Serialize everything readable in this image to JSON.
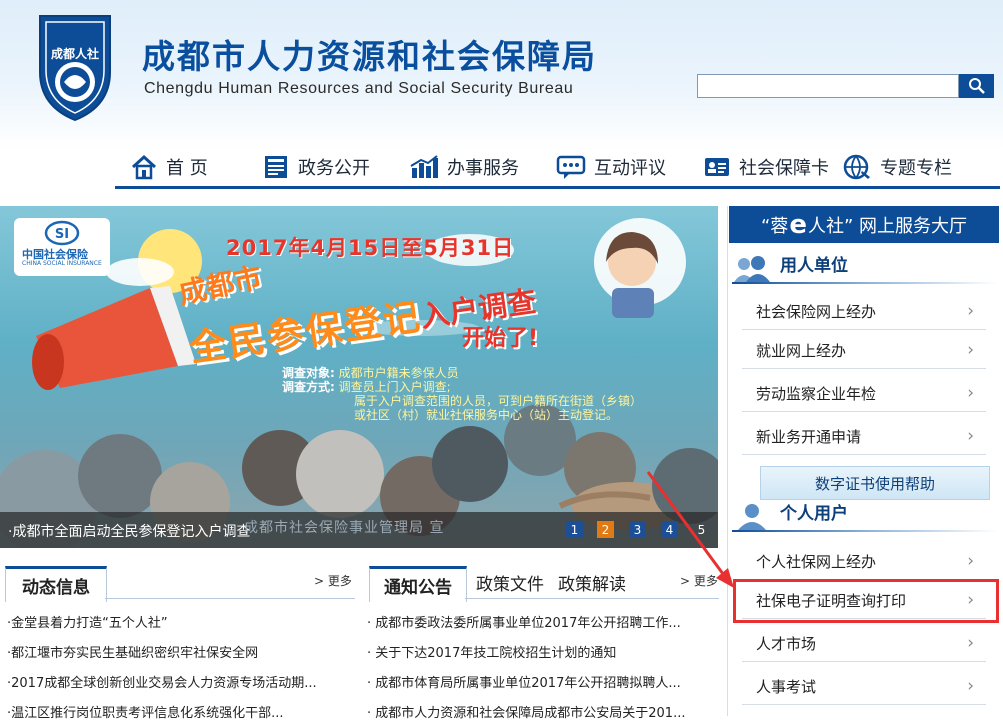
{
  "header": {
    "logo_text": "成都人社",
    "title": "成都市人力资源和社会保障局",
    "subtitle": "Chengdu Human Resources and Social Security Bureau",
    "search": {
      "placeholder": "",
      "value": ""
    }
  },
  "nav": {
    "items": [
      {
        "label": "首 页",
        "icon": "home-icon"
      },
      {
        "label": "政务公开",
        "icon": "document-icon"
      },
      {
        "label": "办事服务",
        "icon": "bar-chart-icon"
      },
      {
        "label": "互动评议",
        "icon": "chat-icon"
      },
      {
        "label": "社会保障卡",
        "icon": "id-card-icon"
      },
      {
        "label": "专题专栏",
        "icon": "globe-icon"
      }
    ]
  },
  "banner": {
    "logo_text": "中国社会保险",
    "logo_sub": "CHINA SOCIAL INSURANCE",
    "date_range": "2017年4月15日至5月31日",
    "headline_city": "成都市",
    "headline_main": "全民参保登记",
    "headline_right": "入户调查",
    "headline_start": "开始了!",
    "target_label": "调查对象:",
    "target_value": "成都市户籍未参保人员",
    "method_label": "调查方式:",
    "method_value": "调查员上门入户调查;",
    "note_line1": "属于入户调查范围的人员，可到户籍所在街道（乡镇）",
    "note_line2": "或社区（村）就业社保服务中心（站）主动登记。",
    "caption": "·成都市全面启动全民参保登记入户调查",
    "caption_secondary": "成都市社会保险事业管理局 宣",
    "pages": [
      "1",
      "2",
      "3",
      "4",
      "5"
    ],
    "active_page": "2"
  },
  "left_news": {
    "tab": "动态信息",
    "more": "> 更多",
    "items": [
      "·金堂县着力打造“五个人社”",
      "·都江堰市夯实民生基础织密织牢社保安全网",
      "·2017成都全球创新创业交易会人力资源专场活动期...",
      "·温江区推行岗位职责考评信息化系统强化干部..."
    ]
  },
  "mid_news": {
    "tabs": [
      "通知公告",
      "政策文件",
      "政策解读"
    ],
    "more": "> 更多",
    "items": [
      "· 成都市委政法委所属事业单位2017年公开招聘工作...",
      "· 关于下达2017年技工院校招生计划的通知",
      "· 成都市体育局所属事业单位2017年公开招聘拟聘人...",
      "· 成都市人力资源和社会保障局成都市公安局关于201..."
    ]
  },
  "services": {
    "header_pre": "“蓉",
    "header_e": "e",
    "header_post": "人社”  网上服务大厅",
    "employer": {
      "label": "用人单位",
      "items": [
        "社会保险网上经办",
        "就业网上经办",
        "劳动监察企业年检",
        "新业务开通申请"
      ]
    },
    "help_label": "数字证书使用帮助",
    "personal": {
      "label": "个人用户",
      "items": [
        "个人社保网上经办",
        "社保电子证明查询打印",
        "人才市场",
        "人事考试"
      ]
    },
    "chevron": "›"
  },
  "colors": {
    "brand": "#0d4d98",
    "highlight": "#e83030",
    "pager_active": "#e07a14"
  }
}
